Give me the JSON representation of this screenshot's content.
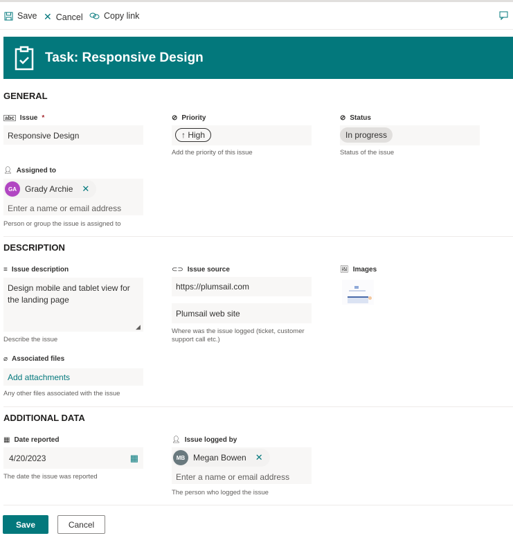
{
  "toolbar": {
    "save": "Save",
    "cancel": "Cancel",
    "copy_link": "Copy link"
  },
  "header": {
    "title": "Task: Responsive Design",
    "color": "#03787c"
  },
  "general": {
    "title": "GENERAL",
    "issue": {
      "label": "Issue",
      "required": "*",
      "value": "Responsive Design"
    },
    "priority": {
      "label": "Priority",
      "value": "High",
      "hint": "Add the priority of this issue"
    },
    "status": {
      "label": "Status",
      "value": "In progress",
      "hint": "Status of the issue"
    },
    "assigned": {
      "label": "Assigned to",
      "person": {
        "initials": "GA",
        "name": "Grady Archie",
        "color": "#b146c2"
      },
      "placeholder": "Enter a name or email address",
      "hint": "Person or group the issue is assigned to"
    }
  },
  "description": {
    "title": "DESCRIPTION",
    "issue_description": {
      "label": "Issue description",
      "value": "Design mobile and tablet view for the landing page",
      "hint": "Describe the issue"
    },
    "issue_source": {
      "label": "Issue source",
      "url": "https://plumsail.com",
      "text": "Plumsail web site",
      "hint": "Where was the issue logged (ticket, customer support call etc.)"
    },
    "images": {
      "label": "Images"
    },
    "files": {
      "label": "Associated files",
      "link": "Add attachments",
      "hint": "Any other files associated with the issue"
    }
  },
  "additional": {
    "title": "ADDITIONAL DATA",
    "date": {
      "label": "Date reported",
      "value": "4/20/2023",
      "hint": "The date the issue was reported"
    },
    "logged_by": {
      "label": "Issue logged by",
      "person": {
        "initials": "MB",
        "name": "Megan Bowen",
        "color": "#69797e"
      },
      "placeholder": "Enter a name or email address",
      "hint": "The person who logged the issue"
    }
  },
  "footer": {
    "save": "Save",
    "cancel": "Cancel"
  }
}
